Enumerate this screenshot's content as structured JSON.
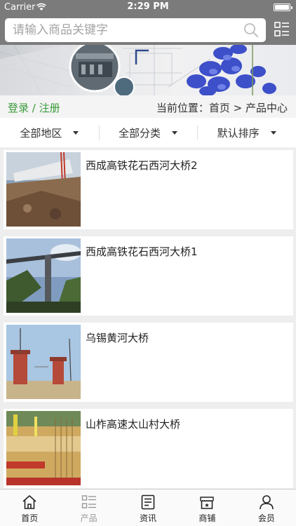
{
  "status_bar": {
    "carrier": "Carrier",
    "time": "2:29 PM"
  },
  "search": {
    "placeholder": "请输入商品关键字"
  },
  "breadcrumb_bar": {
    "login": "登录",
    "separator": " / ",
    "register": "注册",
    "location_label": "当前位置：",
    "home": "首页",
    "arrow": " > ",
    "current": "产品中心"
  },
  "filters": [
    {
      "label": "全部地区"
    },
    {
      "label": "全部分类"
    },
    {
      "label": "默认排序"
    }
  ],
  "products": [
    {
      "title": "西成高铁花石西河大桥2"
    },
    {
      "title": "西成高铁花石西河大桥1"
    },
    {
      "title": "乌锡黄河大桥"
    },
    {
      "title": "山柞高速太山村大桥"
    }
  ],
  "tabbar": [
    {
      "label": "首页",
      "icon": "home-icon"
    },
    {
      "label": "产品",
      "icon": "grid-list-icon"
    },
    {
      "label": "资讯",
      "icon": "news-icon"
    },
    {
      "label": "商铺",
      "icon": "shop-icon"
    },
    {
      "label": "会员",
      "icon": "user-icon"
    }
  ],
  "colors": {
    "header_bg": "#7b7b7b",
    "login_green": "#3a9a3a",
    "page_bg": "#eeeeee"
  }
}
